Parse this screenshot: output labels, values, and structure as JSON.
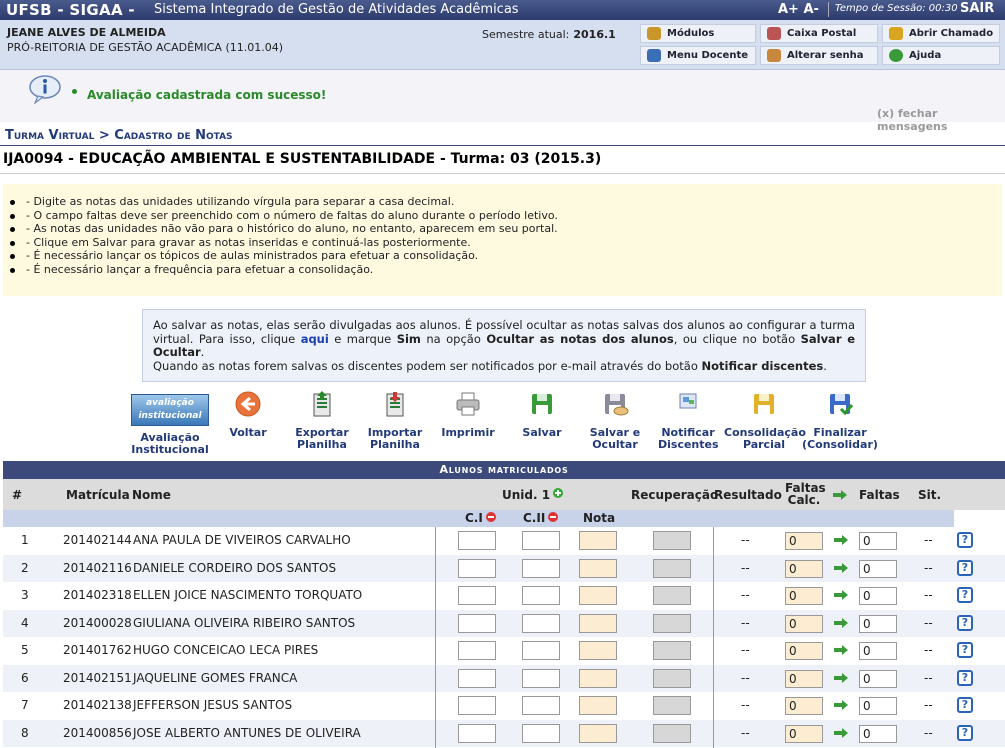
{
  "topbar": {
    "brand": "UFSB - SIGAA -",
    "system_name": "Sistema Integrado de Gestão de Atividades Acadêmicas",
    "font_controls": "A+ A-",
    "session_label": "Tempo de Sessão: 00:30",
    "logout": "SAIR"
  },
  "user": {
    "name": "JEANE ALVES DE ALMEIDA",
    "unit": "PRÓ-REITORIA DE GESTÃO ACADÊMICA (11.01.04)",
    "semester_label": "Semestre atual:",
    "semester_value": "2016.1"
  },
  "quick_menu": {
    "modules": "Módulos",
    "mailbox": "Caixa Postal",
    "ticket": "Abrir Chamado",
    "teacher_menu": "Menu Docente",
    "change_password": "Alterar senha",
    "help": "Ajuda"
  },
  "message": {
    "success": "Avaliação cadastrada com sucesso!",
    "close": "(x) fechar mensagens"
  },
  "breadcrumb": "Turma Virtual > Cadastro de Notas",
  "course_title": "IJA0094 - EDUCAÇÃO AMBIENTAL E SUSTENTABILIDADE - Turma: 03 (2015.3)",
  "tips": [
    "- Digite as notas das unidades utilizando vírgula para separar a casa decimal.",
    "- O campo faltas deve ser preenchido com o número de faltas do aluno durante o período letivo.",
    "- As notas das unidades não vão para o histórico do aluno, no entanto, aparecem em seu portal.",
    "- Clique em Salvar para gravar as notas inseridas e continuá-las posteriormente.",
    "- É necessário lançar os tópicos de aulas ministrados para efetuar a consolidação.",
    "- É necessário lançar a frequência para efetuar a consolidação."
  ],
  "notice": {
    "p1": "Ao salvar as notas, elas serão divulgadas aos alunos. É possível ocultar as notas salvas dos alunos ao configurar a turma virtual. Para isso, clique",
    "link": "aqui",
    "p2": "e marque",
    "sim": "Sim",
    "p3": "na opção",
    "opt": "Ocultar as notas dos alunos",
    "p4": ", ou clique no botão",
    "btn": "Salvar e Ocultar",
    "p5": ".",
    "p6": "Quando as notas forem salvas os discentes podem ser notificados por e-mail através do botão",
    "btn2": "Notificar discentes",
    "p7": "."
  },
  "actions": {
    "inst_eval_banner": "avaliação institucional",
    "inst_eval_1": "Avaliação",
    "inst_eval_2": "Institucional",
    "back": "Voltar",
    "export_1": "Exportar",
    "export_2": "Planilha",
    "import_1": "Importar",
    "import_2": "Planilha",
    "print": "Imprimir",
    "save": "Salvar",
    "save_hide_1": "Salvar e",
    "save_hide_2": "Ocultar",
    "notify_1": "Notificar",
    "notify_2": "Discentes",
    "partial_1": "Consolidação",
    "partial_2": "Parcial",
    "final_1": "Finalizar",
    "final_2": "(Consolidar)"
  },
  "table": {
    "title": "Alunos matriculados",
    "col_num": "#",
    "col_matricula": "Matrícula",
    "col_nome": "Nome",
    "col_unid": "Unid. 1",
    "col_recuperacao": "Recuperação",
    "col_resultado": "Resultado",
    "col_faltas_calc_1": "Faltas",
    "col_faltas_calc_2": "Calc.",
    "col_faltas": "Faltas",
    "col_sit": "Sit.",
    "sub_ci": "C.I",
    "sub_cii": "C.II",
    "sub_nota": "Nota",
    "rows": [
      {
        "n": "1",
        "mat": "201402144",
        "nome": "ANA PAULA DE VIVEIROS CARVALHO",
        "res": "--",
        "fc": "0",
        "f": "0",
        "sit": "--"
      },
      {
        "n": "2",
        "mat": "201402116",
        "nome": "DANIELE CORDEIRO DOS SANTOS",
        "res": "--",
        "fc": "0",
        "f": "0",
        "sit": "--"
      },
      {
        "n": "3",
        "mat": "201402318",
        "nome": "ELLEN JOICE NASCIMENTO TORQUATO",
        "res": "--",
        "fc": "0",
        "f": "0",
        "sit": "--"
      },
      {
        "n": "4",
        "mat": "201400028",
        "nome": "GIULIANA OLIVEIRA RIBEIRO SANTOS",
        "res": "--",
        "fc": "0",
        "f": "0",
        "sit": "--"
      },
      {
        "n": "5",
        "mat": "201401762",
        "nome": "HUGO CONCEICAO LECA PIRES",
        "res": "--",
        "fc": "0",
        "f": "0",
        "sit": "--"
      },
      {
        "n": "6",
        "mat": "201402151",
        "nome": "JAQUELINE GOMES FRANCA",
        "res": "--",
        "fc": "0",
        "f": "0",
        "sit": "--"
      },
      {
        "n": "7",
        "mat": "201402138",
        "nome": "JEFFERSON JESUS SANTOS",
        "res": "--",
        "fc": "0",
        "f": "0",
        "sit": "--"
      },
      {
        "n": "8",
        "mat": "201400856",
        "nome": "JOSE ALBERTO ANTUNES DE OLIVEIRA",
        "res": "--",
        "fc": "0",
        "f": "0",
        "sit": "--"
      }
    ]
  },
  "colors": {
    "header_blue": "#3b4a7a",
    "link_blue": "#233a7a",
    "success_green": "#2a8a2a",
    "tips_bg": "#fefae0",
    "row_alt": "#eef1f7"
  }
}
